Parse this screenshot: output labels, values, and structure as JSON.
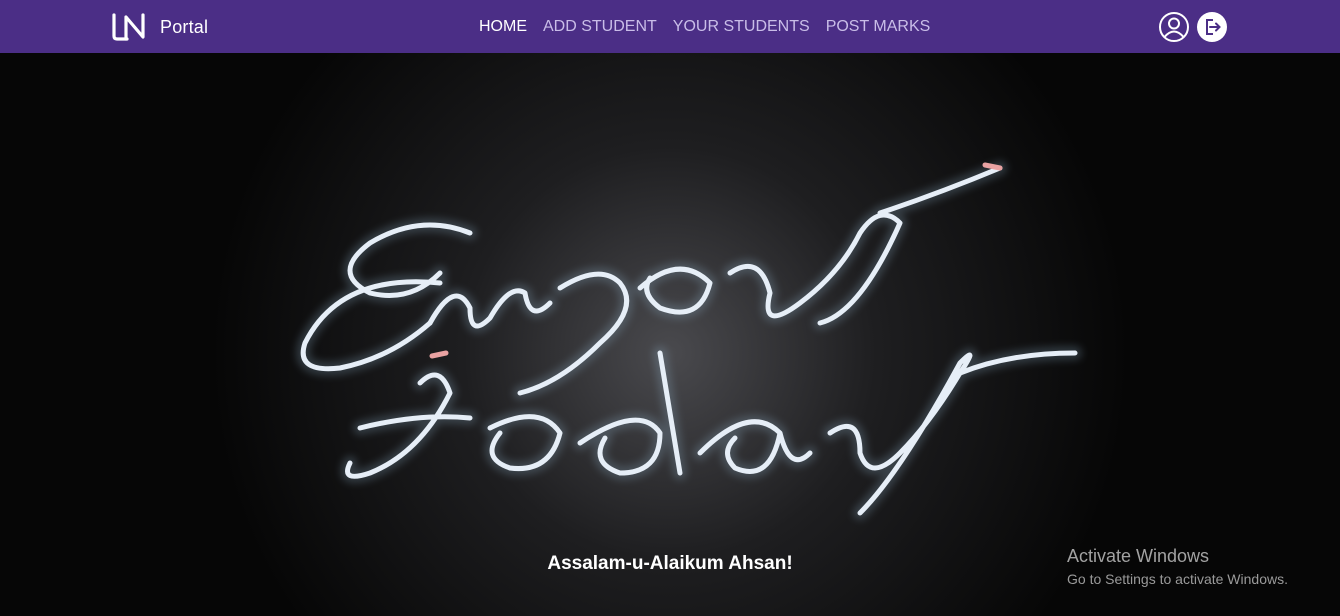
{
  "brand": {
    "logo_mark": "LN",
    "name": "Portal"
  },
  "nav": {
    "items": [
      {
        "label": "HOME",
        "active": true
      },
      {
        "label": "ADD STUDENT",
        "active": false
      },
      {
        "label": "YOUR STUDENTS",
        "active": false
      },
      {
        "label": "POST MARKS",
        "active": false
      }
    ],
    "icons": [
      "user-profile-icon",
      "logout-icon"
    ]
  },
  "hero": {
    "image": "neon sign photo",
    "neon_text": [
      "Enjoy",
      "today"
    ],
    "greeting": "Assalam-u-Alaikum Ahsan!"
  },
  "watermark": {
    "title": "Activate Windows",
    "subtitle": "Go to Settings to activate Windows."
  },
  "colors": {
    "navbar": "#4b2e86",
    "nav_inactive": "#c9bde8",
    "nav_active": "#ffffff",
    "neon": "#e6eef7"
  }
}
